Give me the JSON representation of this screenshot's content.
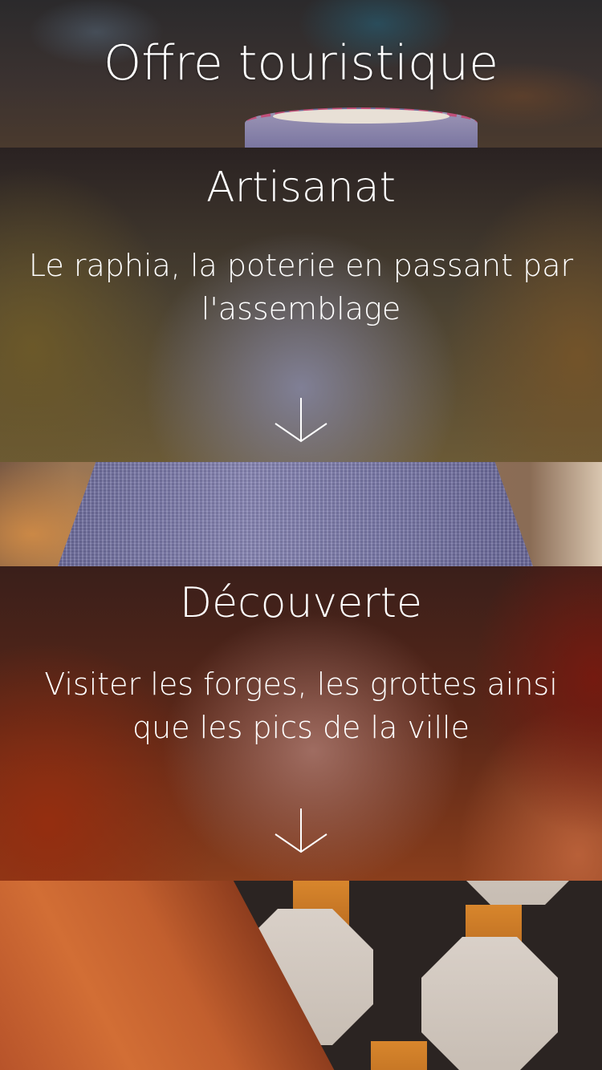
{
  "header": {
    "title": "Offre touristique"
  },
  "cards": [
    {
      "title": "Artisanat",
      "description": "Le raphia, la poterie en passant par l'assemblage",
      "icon": "arrow-down-icon"
    },
    {
      "title": "Découverte",
      "description": "Visiter les forges, les grottes ainsi que les pics de la ville",
      "icon": "arrow-down-icon"
    }
  ],
  "colors": {
    "text": "#ffffff"
  }
}
